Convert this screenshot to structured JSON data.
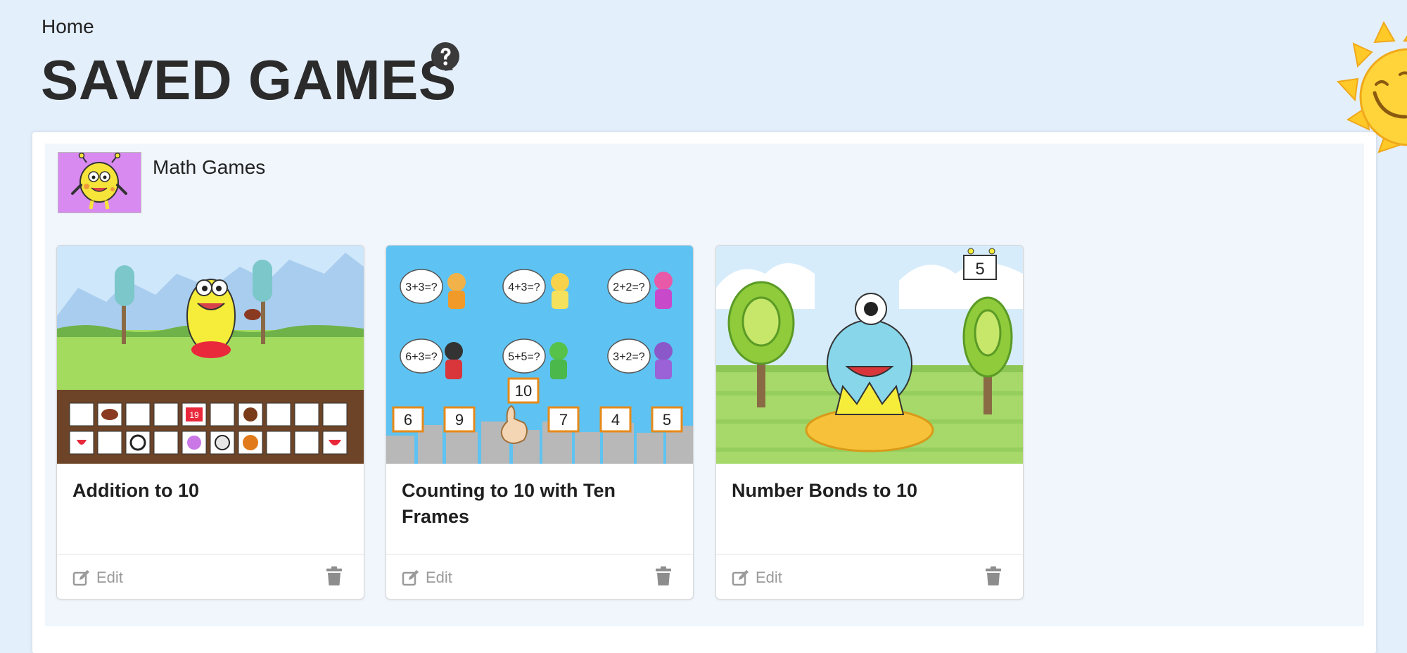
{
  "breadcrumb": {
    "home_label": "Home"
  },
  "page": {
    "title": "SAVED GAMES"
  },
  "category": {
    "title": "Math Games"
  },
  "games": [
    {
      "title": "Addition to 10",
      "edit_label": "Edit",
      "thumbnail_icon": "monster-addition-icon",
      "grid_numbers": [
        "19"
      ]
    },
    {
      "title": "Counting to 10 with Ten Frames",
      "edit_label": "Edit",
      "thumbnail_icon": "superhero-counting-icon",
      "bubbles": [
        "3+3=?",
        "4+3=?",
        "2+2=?",
        "6+3=?",
        "5+5=?",
        "3+2=?"
      ],
      "answer_cards": [
        "6",
        "9",
        "10",
        "7",
        "4",
        "5"
      ]
    },
    {
      "title": "Number Bonds to 10",
      "edit_label": "Edit",
      "thumbnail_icon": "monster-nest-icon",
      "score_value": "5"
    }
  ],
  "colors": {
    "page_background": "#e4effc",
    "panel_inner": "#f1f6fd",
    "category_thumb": "#d88af0",
    "footer_text": "#9a9a9a"
  }
}
